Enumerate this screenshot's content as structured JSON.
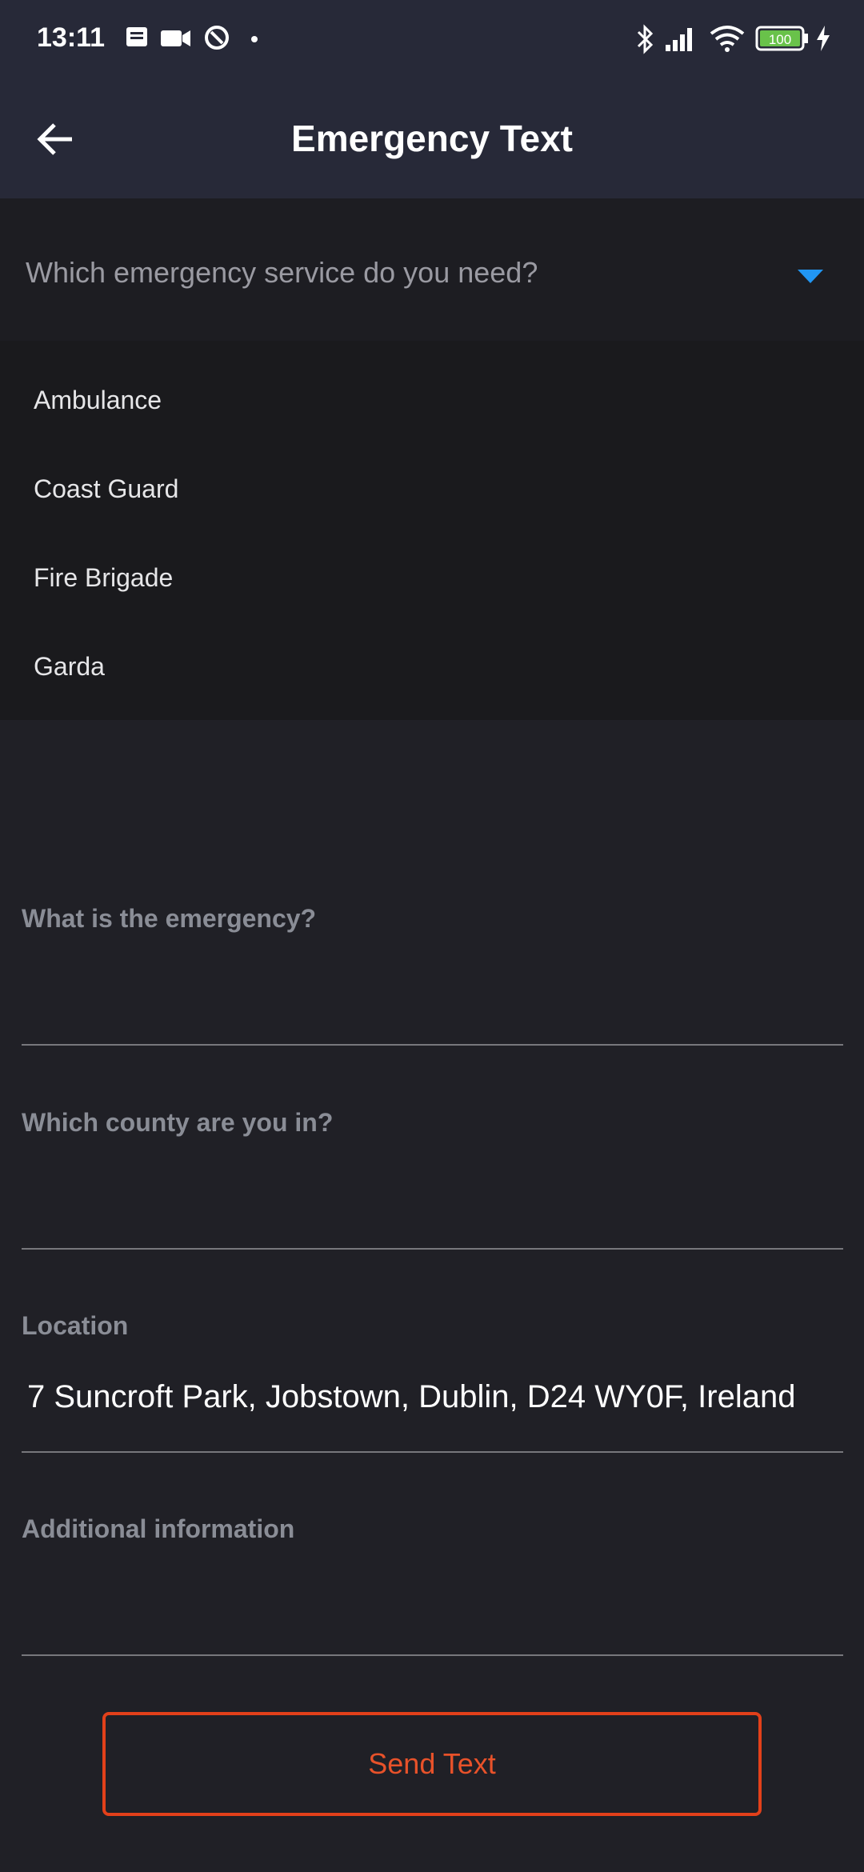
{
  "status_bar": {
    "time": "13:11",
    "battery": "100"
  },
  "app_bar": {
    "title": "Emergency Text",
    "back_icon": "arrow-left-icon"
  },
  "service_select": {
    "placeholder": "Which emergency service do you need?",
    "caret_icon": "caret-down-icon",
    "caret_color": "#2196f3",
    "options": [
      "Ambulance",
      "Coast Guard",
      "Fire Brigade",
      "Garda"
    ]
  },
  "fields": {
    "emergency": {
      "label": "What is the emergency?",
      "value": ""
    },
    "county": {
      "label": "Which county are you in?",
      "value": ""
    },
    "location": {
      "label": "Location",
      "value": "7 Suncroft Park, Jobstown, Dublin, D24 WY0F, Ireland"
    },
    "additional": {
      "label": "Additional information",
      "value": ""
    }
  },
  "send_button": {
    "label": "Send Text",
    "color": "#e2401a"
  }
}
